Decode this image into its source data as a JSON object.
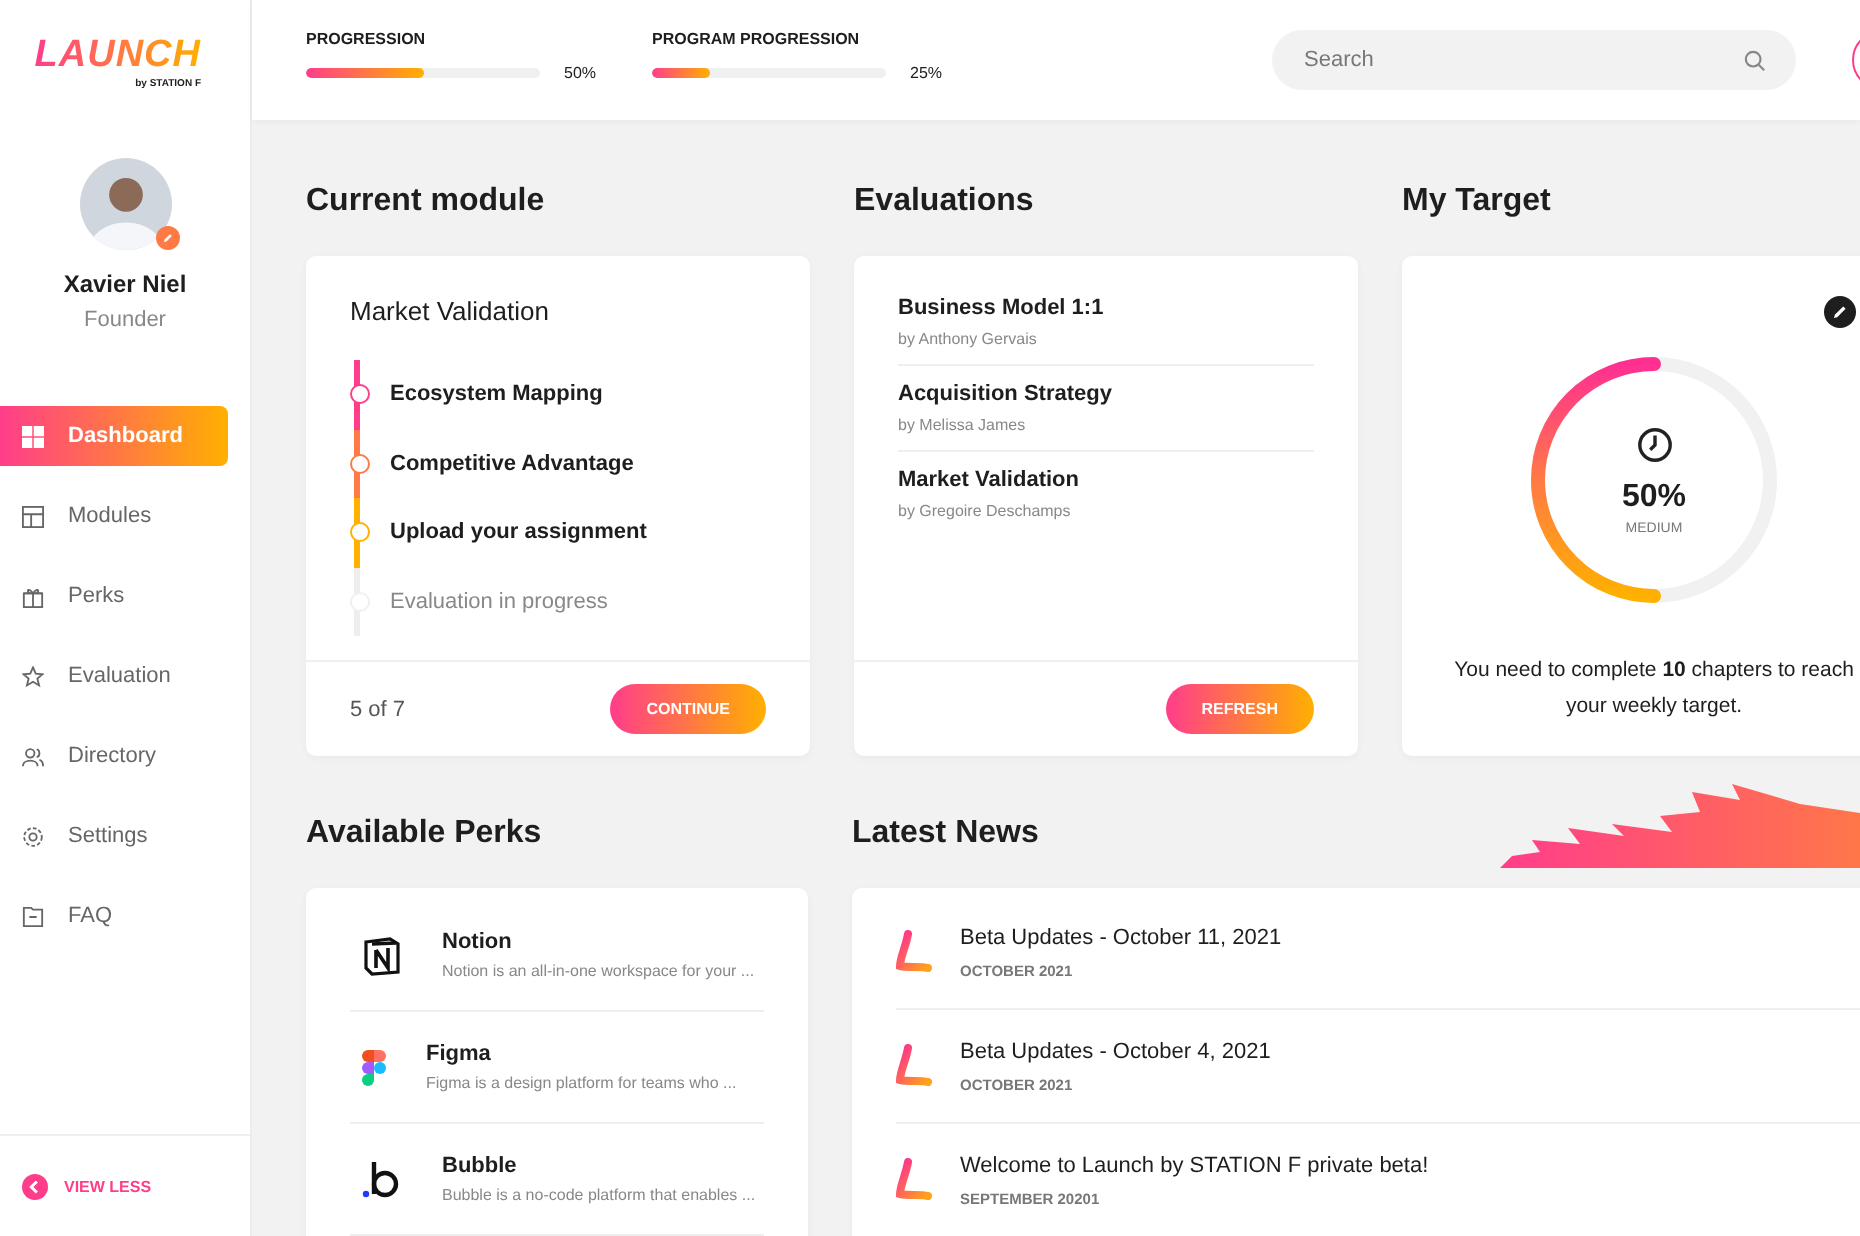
{
  "logo": {
    "title": "LAUNCH",
    "subtitle": "by STATION F"
  },
  "profile": {
    "name": "Xavier Niel",
    "role": "Founder"
  },
  "sidebar": {
    "items": [
      {
        "label": "Dashboard",
        "selected": true
      },
      {
        "label": "Modules",
        "selected": false
      },
      {
        "label": "Perks",
        "selected": false
      },
      {
        "label": "Evaluation",
        "selected": false
      },
      {
        "label": "Directory",
        "selected": false
      },
      {
        "label": "Settings",
        "selected": false
      },
      {
        "label": "FAQ",
        "selected": false
      }
    ],
    "footer_link": "VIEW LESS"
  },
  "header": {
    "progress": [
      {
        "label": "PROGRESSION",
        "level": 0.5,
        "reading": "50%"
      },
      {
        "label": "PROGRAM PROGRESSION",
        "level": 0.25,
        "reading": "25%"
      }
    ],
    "search": {
      "placeholder": "Search"
    }
  },
  "current_module": {
    "heading": "Current module",
    "title": "Market Validation",
    "steps": [
      {
        "label": "Ecosystem Mapping",
        "done": true
      },
      {
        "label": "Competitive Advantage",
        "done": true
      },
      {
        "label": "Upload your assignment",
        "done": true
      },
      {
        "label": "Evaluation in progress",
        "done": false
      }
    ],
    "count": "5 of 7",
    "button": "CONTINUE"
  },
  "evaluations": {
    "heading": "Evaluations",
    "items": [
      {
        "title": "Business Model 1:1",
        "author": "by Anthony Gervais"
      },
      {
        "title": "Acquisition Strategy",
        "author": "by Melissa James"
      },
      {
        "title": "Market Validation",
        "author": "by Gregoire Deschamps"
      }
    ],
    "button": "REFRESH"
  },
  "target": {
    "heading": "My Target",
    "level": 0.5,
    "reading": "50%",
    "label": "MEDIUM",
    "text": "You need to complete **10** chapters to reach your weekly target."
  },
  "perks": {
    "heading": "Available Perks",
    "items": [
      {
        "name": "Notion",
        "description": "Notion is an all-in-one workspace for your ..."
      },
      {
        "name": "Figma",
        "description": "Figma is a design platform for teams who ..."
      },
      {
        "name": "Bubble",
        "description": "Bubble is a no-code platform that enables ..."
      }
    ]
  },
  "news": {
    "heading": "Latest News",
    "items": [
      {
        "title": "Beta Updates - October 11, 2021",
        "date": "OCTOBER 2021"
      },
      {
        "title": "Beta Updates - October 4, 2021",
        "date": "OCTOBER 2021"
      },
      {
        "title": "Welcome to Launch by STATION F private beta!",
        "date": "SEPTEMBER 20201"
      }
    ]
  }
}
